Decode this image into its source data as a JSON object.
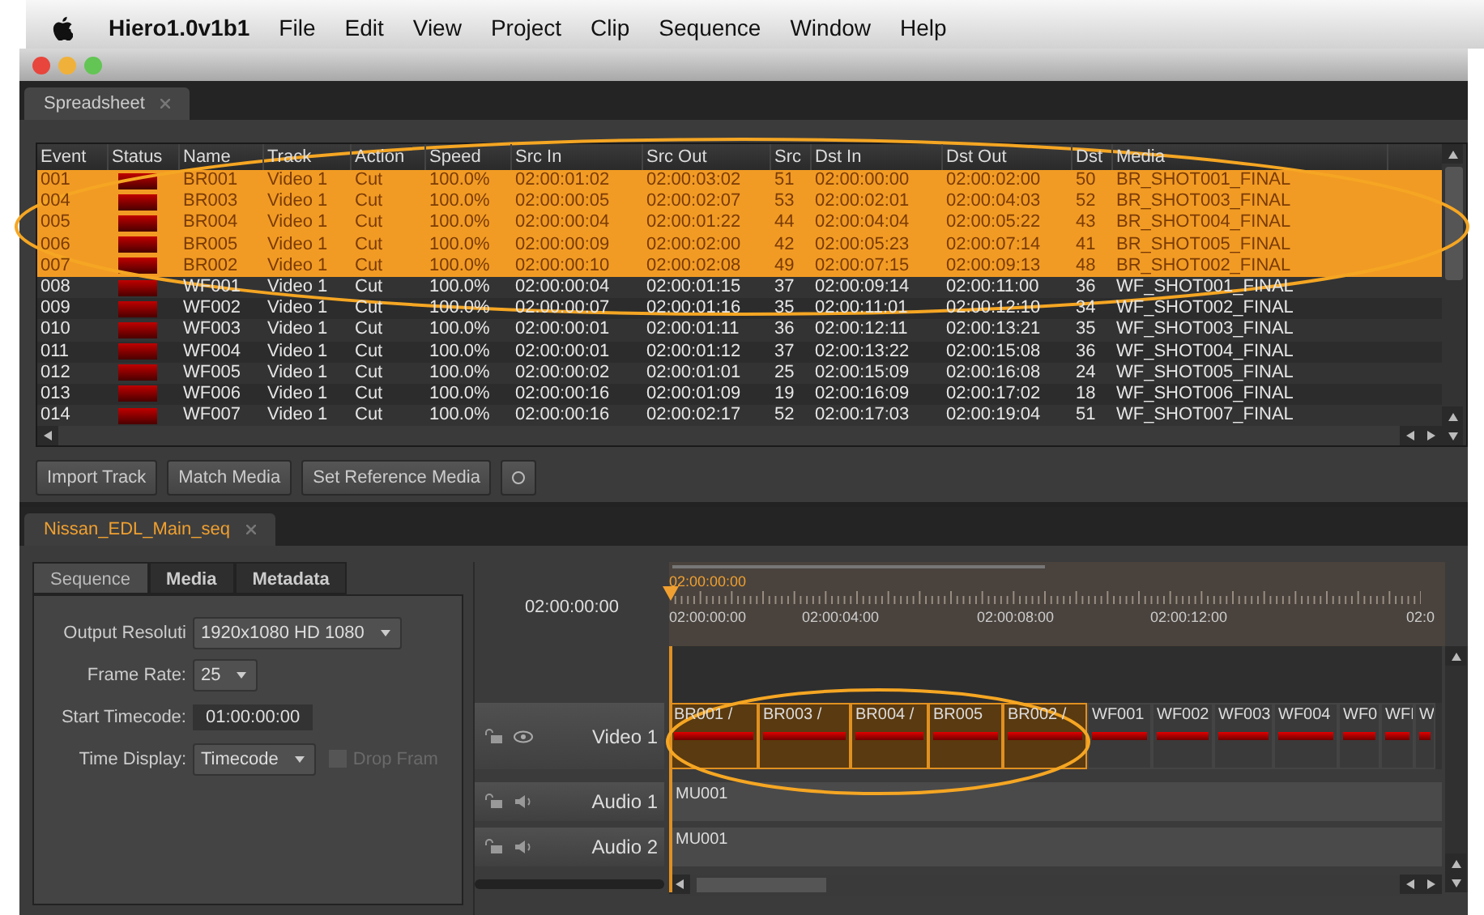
{
  "menu_bar": {
    "app_name": "Hiero1.0v1b1",
    "items": [
      "File",
      "Edit",
      "View",
      "Project",
      "Clip",
      "Sequence",
      "Window",
      "Help"
    ]
  },
  "spreadsheet_tab": {
    "label": "Spreadsheet"
  },
  "table": {
    "columns": [
      "Event",
      "Status",
      "Name",
      "Track",
      "Action",
      "Speed",
      "Src In",
      "Src Out",
      "Src",
      "Dst In",
      "Dst Out",
      "Dst",
      "Media"
    ],
    "rows": [
      {
        "selected": true,
        "event": "001",
        "name": "BR001",
        "track": "Video 1",
        "action": "Cut",
        "speed": "100.0%",
        "src_in": "02:00:01:02",
        "src_out": "02:00:03:02",
        "src": "51",
        "dst_in": "02:00:00:00",
        "dst_out": "02:00:02:00",
        "dst": "50",
        "media": "BR_SHOT001_FINAL"
      },
      {
        "selected": true,
        "event": "004",
        "name": "BR003",
        "track": "Video 1",
        "action": "Cut",
        "speed": "100.0%",
        "src_in": "02:00:00:05",
        "src_out": "02:00:02:07",
        "src": "53",
        "dst_in": "02:00:02:01",
        "dst_out": "02:00:04:03",
        "dst": "52",
        "media": "BR_SHOT003_FINAL"
      },
      {
        "selected": true,
        "event": "005",
        "name": "BR004",
        "track": "Video 1",
        "action": "Cut",
        "speed": "100.0%",
        "src_in": "02:00:00:04",
        "src_out": "02:00:01:22",
        "src": "44",
        "dst_in": "02:00:04:04",
        "dst_out": "02:00:05:22",
        "dst": "43",
        "media": "BR_SHOT004_FINAL"
      },
      {
        "selected": true,
        "event": "006",
        "name": "BR005",
        "track": "Video 1",
        "action": "Cut",
        "speed": "100.0%",
        "src_in": "02:00:00:09",
        "src_out": "02:00:02:00",
        "src": "42",
        "dst_in": "02:00:05:23",
        "dst_out": "02:00:07:14",
        "dst": "41",
        "media": "BR_SHOT005_FINAL"
      },
      {
        "selected": true,
        "event": "007",
        "name": "BR002",
        "track": "Video 1",
        "action": "Cut",
        "speed": "100.0%",
        "src_in": "02:00:00:10",
        "src_out": "02:00:02:08",
        "src": "49",
        "dst_in": "02:00:07:15",
        "dst_out": "02:00:09:13",
        "dst": "48",
        "media": "BR_SHOT002_FINAL"
      },
      {
        "selected": false,
        "event": "008",
        "name": "WF001",
        "track": "Video 1",
        "action": "Cut",
        "speed": "100.0%",
        "src_in": "02:00:00:04",
        "src_out": "02:00:01:15",
        "src": "37",
        "dst_in": "02:00:09:14",
        "dst_out": "02:00:11:00",
        "dst": "36",
        "media": "WF_SHOT001_FINAL"
      },
      {
        "selected": false,
        "event": "009",
        "name": "WF002",
        "track": "Video 1",
        "action": "Cut",
        "speed": "100.0%",
        "src_in": "02:00:00:07",
        "src_out": "02:00:01:16",
        "src": "35",
        "dst_in": "02:00:11:01",
        "dst_out": "02:00:12:10",
        "dst": "34",
        "media": "WF_SHOT002_FINAL"
      },
      {
        "selected": false,
        "event": "010",
        "name": "WF003",
        "track": "Video 1",
        "action": "Cut",
        "speed": "100.0%",
        "src_in": "02:00:00:01",
        "src_out": "02:00:01:11",
        "src": "36",
        "dst_in": "02:00:12:11",
        "dst_out": "02:00:13:21",
        "dst": "35",
        "media": "WF_SHOT003_FINAL"
      },
      {
        "selected": false,
        "event": "011",
        "name": "WF004",
        "track": "Video 1",
        "action": "Cut",
        "speed": "100.0%",
        "src_in": "02:00:00:01",
        "src_out": "02:00:01:12",
        "src": "37",
        "dst_in": "02:00:13:22",
        "dst_out": "02:00:15:08",
        "dst": "36",
        "media": "WF_SHOT004_FINAL"
      },
      {
        "selected": false,
        "event": "012",
        "name": "WF005",
        "track": "Video 1",
        "action": "Cut",
        "speed": "100.0%",
        "src_in": "02:00:00:02",
        "src_out": "02:00:01:01",
        "src": "25",
        "dst_in": "02:00:15:09",
        "dst_out": "02:00:16:08",
        "dst": "24",
        "media": "WF_SHOT005_FINAL"
      },
      {
        "selected": false,
        "event": "013",
        "name": "WF006",
        "track": "Video 1",
        "action": "Cut",
        "speed": "100.0%",
        "src_in": "02:00:00:16",
        "src_out": "02:00:01:09",
        "src": "19",
        "dst_in": "02:00:16:09",
        "dst_out": "02:00:17:02",
        "dst": "18",
        "media": "WF_SHOT006_FINAL"
      },
      {
        "selected": false,
        "event": "014",
        "name": "WF007",
        "track": "Video 1",
        "action": "Cut",
        "speed": "100.0%",
        "src_in": "02:00:00:16",
        "src_out": "02:00:02:17",
        "src": "52",
        "dst_in": "02:00:17:03",
        "dst_out": "02:00:19:04",
        "dst": "51",
        "media": "WF_SHOT007_FINAL"
      }
    ]
  },
  "buttons": [
    "Import Track",
    "Match Media",
    "Set Reference Media"
  ],
  "sequence_tab": {
    "label": "Nissan_EDL_Main_seq"
  },
  "inspector": {
    "tabs": [
      {
        "label": "Sequence",
        "selected": true
      },
      {
        "label": "Media",
        "selected": false
      },
      {
        "label": "Metadata",
        "selected": false
      }
    ],
    "fields": [
      {
        "label": "Output Resoluti",
        "kind": "dropdown",
        "value": "1920x1080 HD 1080"
      },
      {
        "label": "Frame Rate:",
        "kind": "dropdown",
        "value": "25"
      },
      {
        "label": "Start Timecode:",
        "kind": "text",
        "value": "01:00:00:00"
      },
      {
        "label": "Time Display:",
        "kind": "dropdown",
        "value": "Timecode"
      }
    ],
    "drop_frame": {
      "label": "Drop Fram",
      "checked": false,
      "disabled": true
    }
  },
  "timeline": {
    "timecode": "02:00:00:00",
    "playhead_label": "02:00:00:00",
    "ruler_labels": [
      "02:00:00:00",
      "02:00:04:00",
      "02:00:08:00",
      "02:00:12:00",
      "02:0"
    ],
    "tracks": [
      {
        "name": "Video 1",
        "kind": "video",
        "clips": [
          {
            "label": "BR001 /",
            "selected": true
          },
          {
            "label": "BR003 /",
            "selected": true
          },
          {
            "label": "BR004 /",
            "selected": true
          },
          {
            "label": "BR005",
            "selected": true
          },
          {
            "label": "BR002 /",
            "selected": true
          },
          {
            "label": "WF001",
            "selected": false
          },
          {
            "label": "WF002",
            "selected": false
          },
          {
            "label": "WF003",
            "selected": false
          },
          {
            "label": "WF004",
            "selected": false
          },
          {
            "label": "WF0",
            "selected": false
          },
          {
            "label": "WFI",
            "selected": false
          },
          {
            "label": "W",
            "selected": false
          }
        ]
      },
      {
        "name": "Audio 1",
        "kind": "audio",
        "clips": [
          {
            "label": "MU001",
            "selected": false
          }
        ]
      },
      {
        "name": "Audio 2",
        "kind": "audio",
        "clips": [
          {
            "label": "MU001",
            "selected": false
          }
        ]
      }
    ]
  }
}
